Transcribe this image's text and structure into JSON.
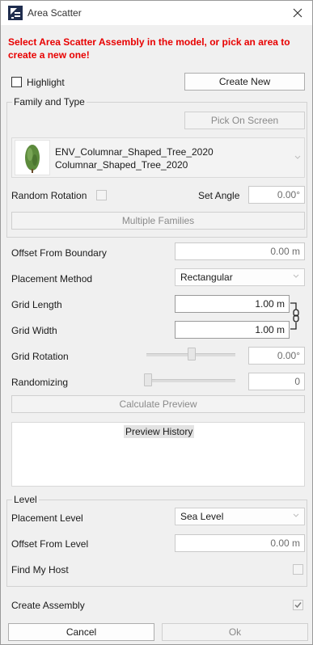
{
  "window": {
    "title": "Area Scatter",
    "icon": "area-scatter-app-icon",
    "close_icon": "close-icon"
  },
  "instructions": {
    "line1": "Select Area Scatter Assembly in the model, or pick an area to",
    "line2": "create a new one!"
  },
  "highlight": {
    "label": "Highlight",
    "checked": false
  },
  "create_new_label": "Create New",
  "family_group": {
    "title": "Family and Type",
    "pick_on_screen_label": "Pick On Screen",
    "family_name": "ENV_Columnar_Shaped_Tree_2020",
    "type_name": "Columnar_Shaped_Tree_2020",
    "random_rotation_label": "Random Rotation",
    "random_rotation_checked": false,
    "set_angle_label": "Set Angle",
    "set_angle_value": "0.00°",
    "multiple_families_label": "Multiple Families"
  },
  "params": {
    "offset_boundary_label": "Offset From Boundary",
    "offset_boundary_value": "0.00 m",
    "placement_method_label": "Placement Method",
    "placement_method_value": "Rectangular",
    "grid_length_label": "Grid Length",
    "grid_length_value": "1.00 m",
    "grid_width_label": "Grid Width",
    "grid_width_value": "1.00 m",
    "grid_rotation_label": "Grid Rotation",
    "grid_rotation_value": "0.00°",
    "grid_rotation_slider_fraction": 0.5,
    "randomizing_label": "Randomizing",
    "randomizing_value": "0",
    "randomizing_slider_fraction": 0.0
  },
  "calculate_preview_label": "Calculate Preview",
  "preview_history_label": "Preview History",
  "level_group": {
    "title": "Level",
    "placement_level_label": "Placement Level",
    "placement_level_value": "Sea Level",
    "offset_level_label": "Offset From Level",
    "offset_level_value": "0.00 m",
    "find_host_label": "Find My Host",
    "find_host_checked": false
  },
  "create_assembly": {
    "label": "Create Assembly",
    "checked": true
  },
  "footer": {
    "cancel_label": "Cancel",
    "ok_label": "Ok"
  },
  "colors": {
    "warning_text": "#e80000",
    "window_bg": "#f0f0f0",
    "tree_green": "#5c8a3c"
  }
}
